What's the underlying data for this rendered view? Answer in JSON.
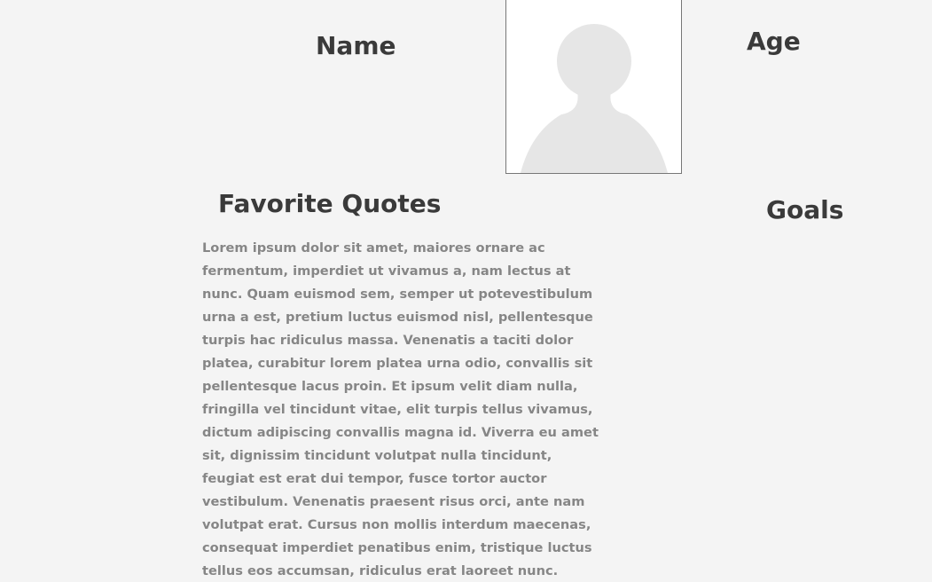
{
  "profile": {
    "name_label": "Name",
    "age_label": "Age",
    "quotes_label": "Favorite Quotes",
    "goals_label": "Goals",
    "avatar_icon": "user-silhouette-icon",
    "quote_text": "Lorem ipsum dolor sit amet, maiores ornare ac fermentum, imperdiet ut vivamus a, nam lectus at nunc. Quam euismod sem, semper ut potevestibulum urna a est, pretium luctus euismod nisl, pellentesque turpis hac ridiculus massa. Venenatis a taciti dolor platea, curabitur lorem platea urna odio, convallis sit pellentesque lacus proin. Et ipsum velit diam nulla, fringilla vel tincidunt vitae, elit turpis tellus vivamus, dictum adipiscing convallis magna id. Viverra eu amet sit, dignissim tincidunt volutpat nulla tincidunt, feugiat est erat dui tempor, fusce tortor auctor vestibulum. Venenatis praesent risus orci, ante nam volutpat erat. Cursus non mollis interdum maecenas, consequat imperdiet penatibus enim, tristique luctus tellus eos accumsan, ridiculus erat laoreet nunc."
  },
  "colors": {
    "background": "#f4f4f4",
    "heading": "#3a3a3a",
    "body_text": "#868686",
    "avatar_fill": "#e6e6e6",
    "avatar_border": "#777777"
  }
}
